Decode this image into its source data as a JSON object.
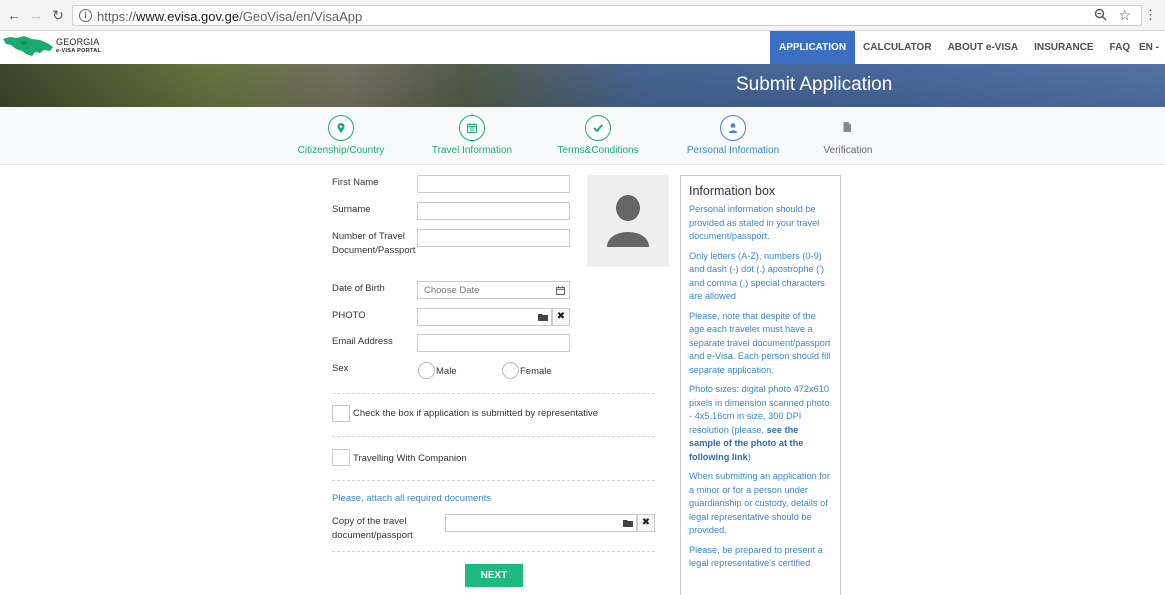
{
  "browser": {
    "url_scheme": "https://",
    "url_host": "www.evisa.gov.ge",
    "url_path": "/GeoVisa/en/VisaApp"
  },
  "header": {
    "logo_line1": "GEORGIA",
    "logo_line2": "e-VISA PORTAL",
    "nav": [
      "APPLICATION",
      "CALCULATOR",
      "ABOUT e-VISA",
      "INSURANCE",
      "FAQ"
    ],
    "lang": "EN -",
    "accent_color": "#3a6fc4"
  },
  "banner": {
    "title": "Submit Application"
  },
  "steps": [
    {
      "label": "Citizenship/Country",
      "icon": "map-pin-icon",
      "state": "done"
    },
    {
      "label": "Travel Information",
      "icon": "calendar-icon",
      "state": "done"
    },
    {
      "label": "Terms&Conditions",
      "icon": "check-icon",
      "state": "done"
    },
    {
      "label": "Personal Information",
      "icon": "user-icon",
      "state": "current"
    },
    {
      "label": "Verification",
      "icon": "document-icon",
      "state": "pending"
    }
  ],
  "form": {
    "first_name_label": "First Name",
    "surname_label": "Surname",
    "doc_number_label": "Number of Travel Document/Passport",
    "dob_label": "Date of Birth",
    "dob_placeholder": "Choose Date",
    "photo_label": "PHOTO",
    "email_label": "Email Address",
    "sex_label": "Sex",
    "sex_options": [
      "Male",
      "Female"
    ],
    "representative_label": "Check the box if application is submitted by representative",
    "companion_label": "Travelling With Companion",
    "attach_note": "Please, attach all required documents",
    "copy_doc_label": "Copy of the travel document/passport",
    "clear_symbol": "✖",
    "next_label": "NEXT"
  },
  "info_box": {
    "title": "Information box",
    "p1": "Personal information should be provided as stated in your travel document/passport.",
    "p2": "Only letters (A-Z), numbers (0-9) and dash (-) dot (.) apostrophe (') and comma (,) special characters are allowed",
    "p3": "Please, note that despite of the age each traveler must have a separate travel document/passport and e-Visa. Each person should fill separate application.",
    "p4_text": "Photo sizes: digital photo 472x610 pixels in dimension scanned photo - 4x5.16cm in size, 300 DPI resolution (please, ",
    "p4_link": "see the sample of the photo at the following link",
    "p4_end": ")",
    "p5": "When submitting an application for a minor or for a person under guardianship or custody, details of legal representative should be provided.",
    "p6": "Please, be prepared to present a legal representative's certified"
  },
  "colors": {
    "green": "#1aaa72",
    "blue": "#3a86cf",
    "next_button": "#1db97f"
  }
}
